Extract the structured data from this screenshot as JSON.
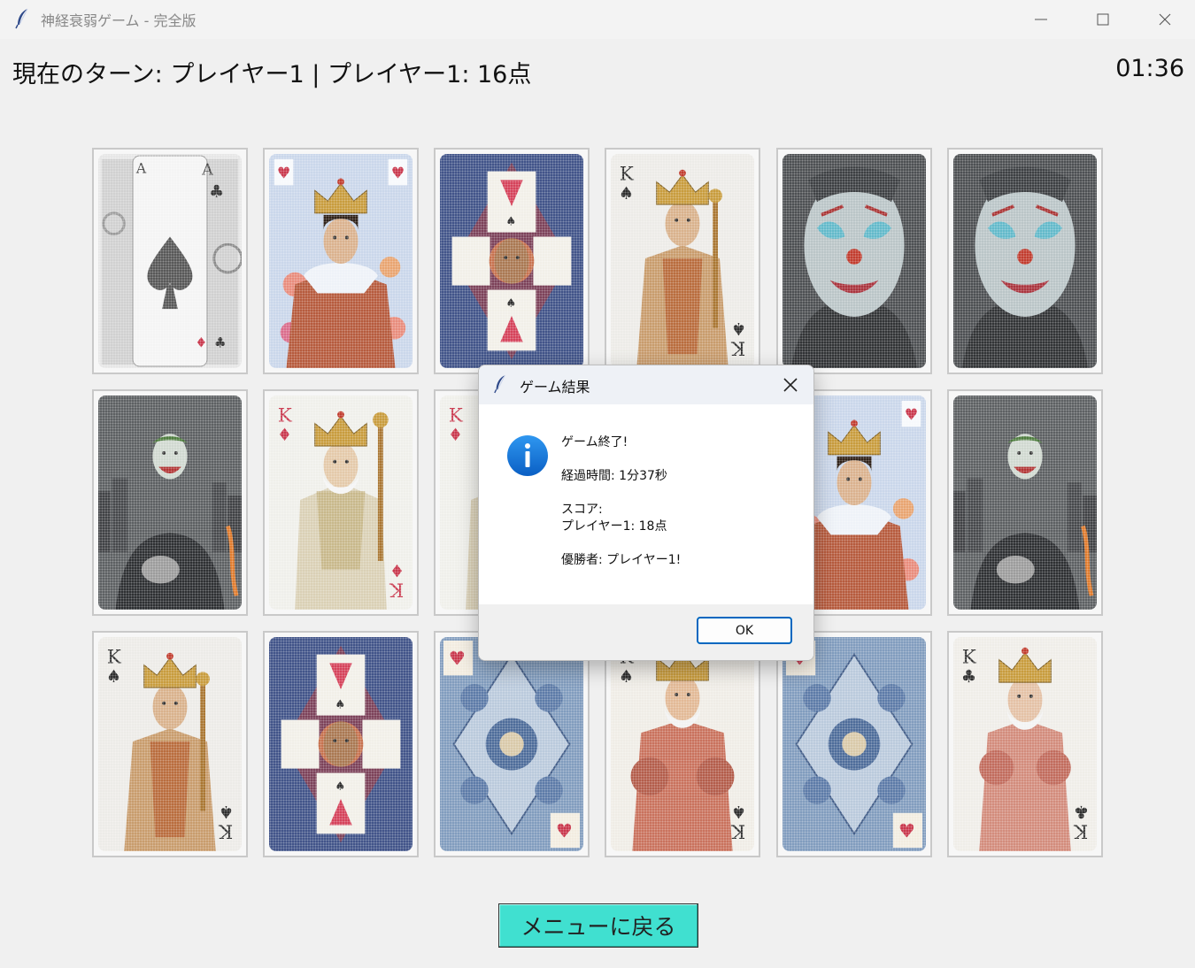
{
  "window": {
    "title": "神経衰弱ゲーム - 完全版"
  },
  "status": {
    "text": "現在のターン: プレイヤー1 | プレイヤー1: 16点",
    "timer": "01:36"
  },
  "cards": [
    {
      "id": "card-1-1",
      "kind": "ace-spades"
    },
    {
      "id": "card-1-2",
      "kind": "king-hearts-crown"
    },
    {
      "id": "card-1-3",
      "kind": "navy-ornate"
    },
    {
      "id": "card-1-4",
      "kind": "king-spades-tan"
    },
    {
      "id": "card-1-5",
      "kind": "joker-face"
    },
    {
      "id": "card-1-6",
      "kind": "joker-face"
    },
    {
      "id": "card-2-1",
      "kind": "joker-city"
    },
    {
      "id": "card-2-2",
      "kind": "king-diamonds"
    },
    {
      "id": "card-2-3",
      "kind": "king-diamonds"
    },
    {
      "id": "card-2-4",
      "kind": "hidden"
    },
    {
      "id": "card-2-5",
      "kind": "king-hearts-crown"
    },
    {
      "id": "card-2-6",
      "kind": "joker-city"
    },
    {
      "id": "card-3-1",
      "kind": "king-spades-tan"
    },
    {
      "id": "card-3-2",
      "kind": "navy-ornate"
    },
    {
      "id": "card-3-3",
      "kind": "blue-hearts-ornate"
    },
    {
      "id": "card-3-4",
      "kind": "king-red-spades"
    },
    {
      "id": "card-3-5",
      "kind": "blue-hearts-ornate"
    },
    {
      "id": "card-3-6",
      "kind": "king-clubs"
    }
  ],
  "menu_button": {
    "label": "メニューに戻る"
  },
  "dialog": {
    "title": "ゲーム結果",
    "lines": [
      "ゲーム終了!",
      "",
      "経過時間: 1分37秒",
      "",
      "スコア:",
      "プレイヤー1: 18点",
      "",
      "優勝者: プレイヤー1!"
    ],
    "ok_label": "OK"
  },
  "colors": {
    "menu_button": "#40e0d0",
    "dialog_accent": "#0067c0",
    "info_icon": "#0a74d6"
  },
  "icons": [
    "feather-icon",
    "minimize-icon",
    "maximize-icon",
    "close-icon",
    "info-icon"
  ]
}
